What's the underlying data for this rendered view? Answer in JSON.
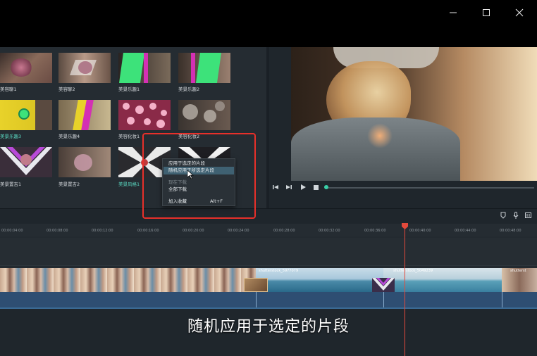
{
  "media_items": [
    {
      "label": "美容聊1"
    },
    {
      "label": "美容聊2"
    },
    {
      "label": "美景乐趣1"
    },
    {
      "label": "美景乐趣2"
    },
    {
      "label": "美景乐趣3"
    },
    {
      "label": "美景乐趣4"
    },
    {
      "label": "美容化妆1"
    },
    {
      "label": "美容化妆2"
    },
    {
      "label": "美景置吉1"
    },
    {
      "label": "美景置吉2"
    },
    {
      "label": "美景风格1"
    }
  ],
  "context_menu": {
    "items": [
      {
        "label": "应用于选定的片段",
        "state": "normal"
      },
      {
        "label": "随机应用于所选定片段",
        "state": "hover"
      },
      {
        "label": "现在下载",
        "state": "disabled"
      },
      {
        "label": "全部下载",
        "state": "normal"
      },
      {
        "label": "加入收藏",
        "shortcut": "Alt+F",
        "state": "normal"
      }
    ]
  },
  "ruler": {
    "labels": [
      "00:00:04:00",
      "00:00:08:00",
      "00:00:12:00",
      "00:00:16:00",
      "00:00:20:00",
      "00:00:24:00",
      "00:00:28:00",
      "00:00:32:00",
      "00:00:36:00",
      "00:00:40:00",
      "00:00:44:00",
      "00:00:48:00"
    ]
  },
  "clips": [
    {
      "name": "shutterstock_5977079"
    },
    {
      "name": "shutterstock_5049239"
    },
    {
      "name": "shutterst"
    }
  ],
  "caption": "随机应用于选定的片段",
  "colors": {
    "accent": "#3ad0a8",
    "playhead": "#e34a3c",
    "callout": "#e8302a",
    "menu_hover": "#3f6172"
  }
}
